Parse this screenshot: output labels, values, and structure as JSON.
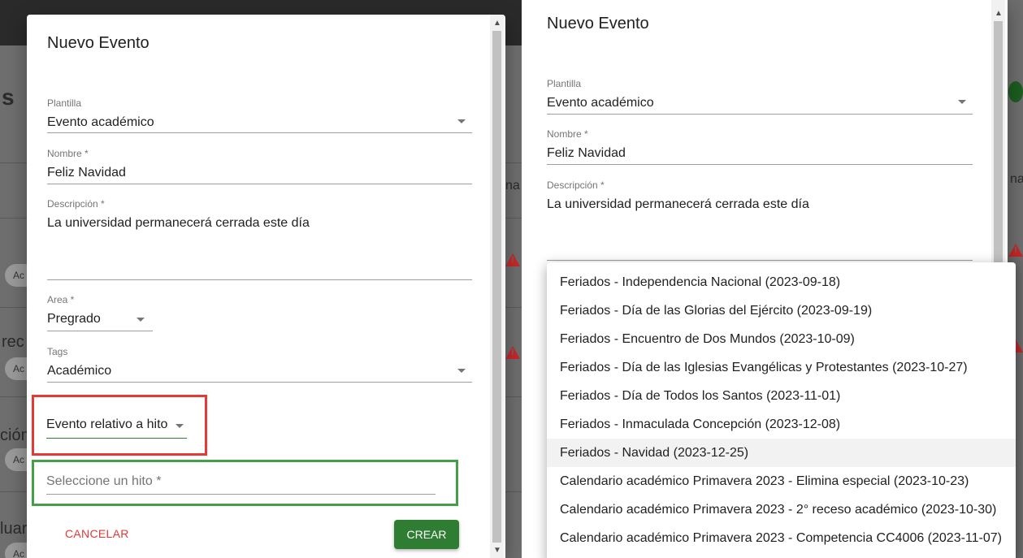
{
  "dialog": {
    "title": "Nuevo Evento",
    "plantilla_label": "Plantilla",
    "plantilla_value": "Evento académico",
    "nombre_label": "Nombre *",
    "nombre_value": "Feliz Navidad",
    "descripcion_label": "Descripción *",
    "descripcion_value": "La universidad permanecerá cerrada este día",
    "area_label": "Area *",
    "area_value": "Pregrado",
    "tags_label": "Tags",
    "tags_value": "Académico",
    "tipo_value": "Evento relativo a hito",
    "hito_placeholder": "Seleccione un hito *",
    "cancel_label": "CANCELAR",
    "create_label": "CREAR"
  },
  "background": {
    "fragments": [
      "s",
      "na",
      "Ac",
      "rec",
      "Ac",
      "ción",
      "Ac",
      "luar",
      "Ac"
    ]
  },
  "hito_options": [
    "Feriados - Independencia Nacional (2023-09-18)",
    "Feriados - Día de las Glorias del Ejército (2023-09-19)",
    "Feriados - Encuentro de Dos Mundos (2023-10-09)",
    "Feriados - Día de las Iglesias Evangélicas y Protestantes (2023-10-27)",
    "Feriados - Día de Todos los Santos (2023-11-01)",
    "Feriados - Inmaculada Concepción (2023-12-08)",
    "Feriados - Navidad (2023-12-25)",
    "Calendario académico Primavera 2023 - Elimina especial (2023-10-23)",
    "Calendario académico Primavera 2023 - 2° receso académico (2023-10-30)",
    "Calendario académico Primavera 2023 - Competencia CC4006 (2023-11-07)"
  ],
  "hovered_option": "Feriados - Navidad (2023-12-25)",
  "colors": {
    "cancel": "#e53935",
    "create": "#2e7d32",
    "highlight_red": "#e53935",
    "highlight_green": "#43a047"
  }
}
